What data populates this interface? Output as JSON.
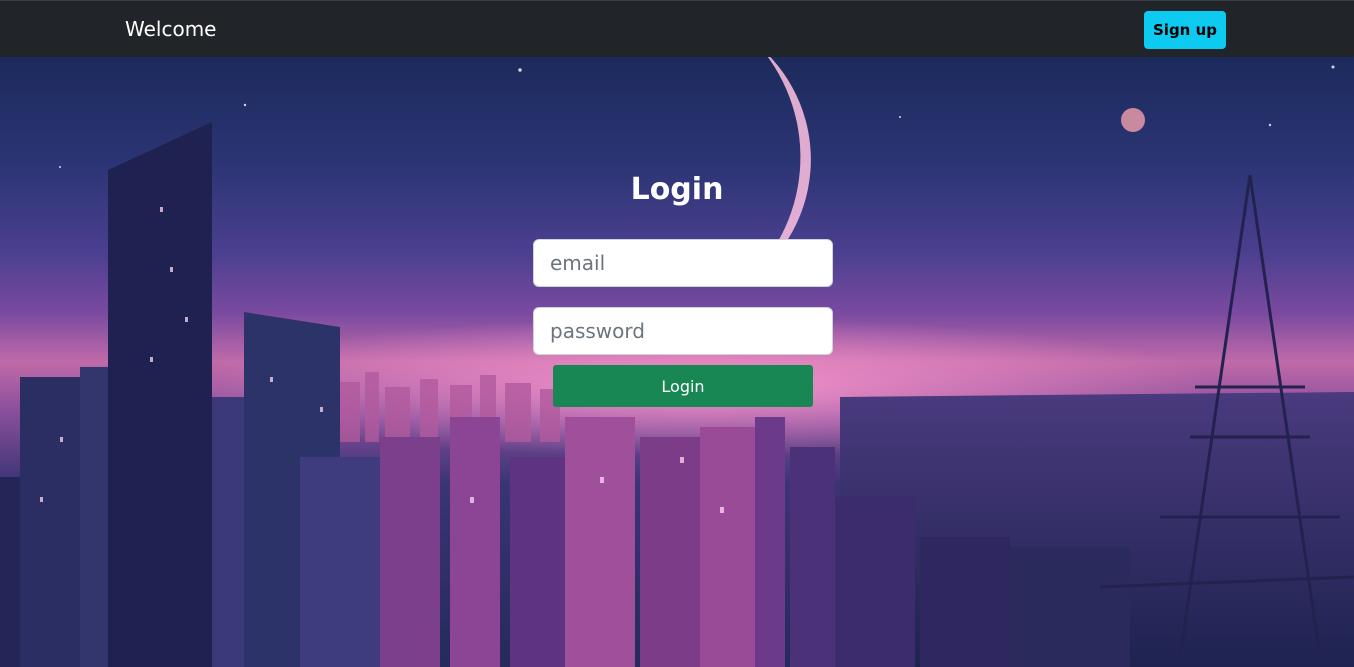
{
  "navbar": {
    "brand": "Welcome",
    "signup_label": "Sign up",
    "signup_color": "#0dcaf0",
    "background": "#212529"
  },
  "login": {
    "title": "Login",
    "email_placeholder": "email",
    "password_placeholder": "password",
    "submit_label": "Login",
    "submit_color": "#198754"
  }
}
